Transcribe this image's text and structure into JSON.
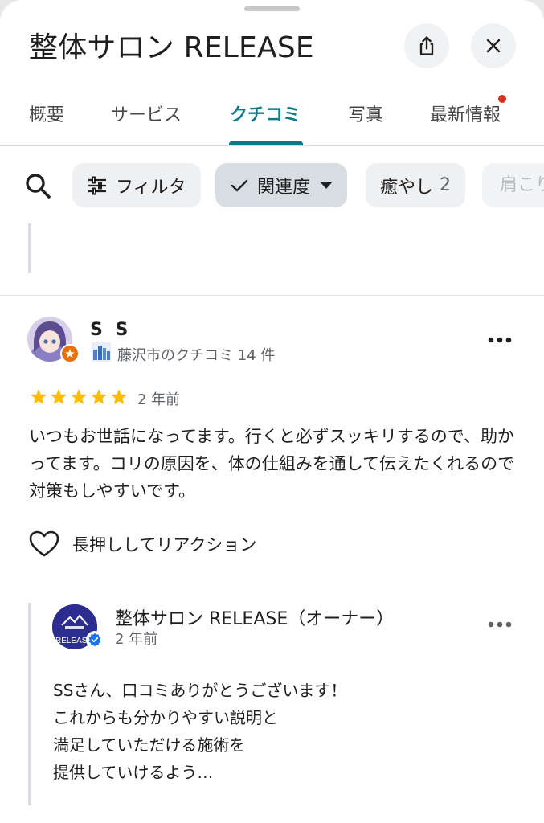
{
  "header": {
    "title": "整体サロン RELEASE",
    "share_icon": "share-icon",
    "close_icon": "close-icon"
  },
  "tabs": [
    {
      "label": "概要",
      "active": false
    },
    {
      "label": "サービス",
      "active": false
    },
    {
      "label": "クチコミ",
      "active": true
    },
    {
      "label": "写真",
      "active": false
    },
    {
      "label": "最新情報",
      "active": false,
      "has_notification_dot": true
    }
  ],
  "filters": {
    "search_icon": "search-icon",
    "chips": [
      {
        "label": "フィルタ",
        "icon": "tune-icon"
      },
      {
        "label": "関連度",
        "icon": "check-icon",
        "selected": true,
        "dropdown": true
      },
      {
        "label": "癒やし",
        "count": "2"
      },
      {
        "label": "肩こり"
      }
    ]
  },
  "review": {
    "reviewer_name": "S S",
    "reviewer_meta": "藤沢市のクチコミ 14 件",
    "rating": 5,
    "date": "2 年前",
    "text": "いつもお世話になってます。行くと必ずスッキリするので、助かってます。コリの原因を、体の仕組みを通して伝えたくれるので対策もしやすいです。",
    "reaction_label": "長押ししてリアクション"
  },
  "owner_reply": {
    "name": "整体サロン RELEASE（オーナー）",
    "date": "2 年前",
    "avatar_text": "RELEASE",
    "lines": [
      "SSさん、口コミありがとうございます！",
      "これからも分かりやすい説明と",
      "満足していただける施術を",
      "提供していけるよう…"
    ]
  },
  "colors": {
    "accent": "#0b7a87",
    "star": "#fbbc04",
    "notification_dot": "#d93025",
    "guide_badge": "#e8710a",
    "verified": "#1a73e8"
  }
}
